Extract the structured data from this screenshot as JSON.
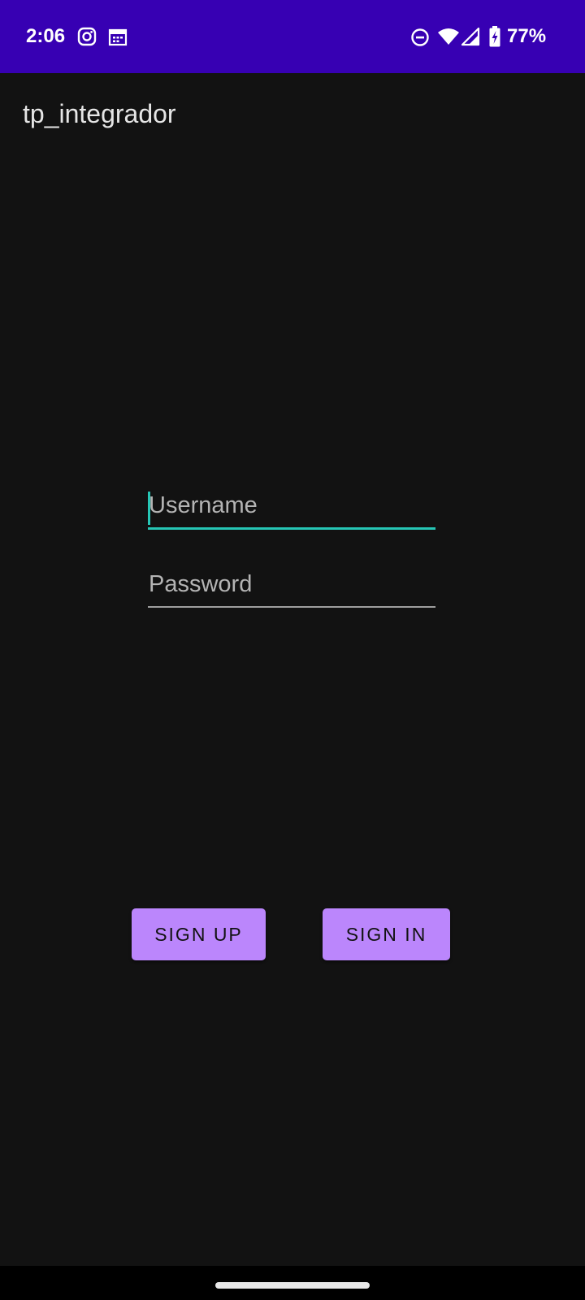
{
  "status_bar": {
    "time": "2:06",
    "battery": "77%",
    "icons": [
      "instagram-icon",
      "calendar-icon",
      "do-not-disturb-icon",
      "wifi-icon",
      "signal-icon",
      "battery-charging-icon"
    ],
    "color": "#3700b3"
  },
  "app_bar": {
    "title": "tp_integrador"
  },
  "form": {
    "username": {
      "value": "",
      "placeholder": "Username",
      "focused": true
    },
    "password": {
      "value": "",
      "placeholder": "Password"
    }
  },
  "buttons": {
    "sign_up": "SIGN UP",
    "sign_in": "SIGN IN",
    "color": "#bb86fc"
  },
  "theme": {
    "background": "#121212",
    "accent": "#26c6b5"
  }
}
